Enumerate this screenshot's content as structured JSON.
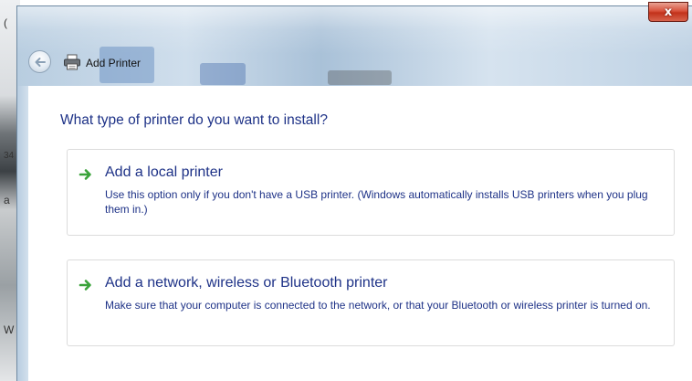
{
  "left_strip": {
    "glyphs": [
      "(",
      "34",
      "a",
      "W"
    ]
  },
  "window": {
    "title": "Add Printer",
    "close_label": "x",
    "icons": {
      "back": "back-arrow-icon",
      "title": "printer-icon",
      "option": "green-arrow-icon"
    },
    "colors": {
      "heading": "#1e3287",
      "close": "#c2321b",
      "option_arrow": "#3aa33a"
    }
  },
  "content": {
    "heading": "What type of printer do you want to install?",
    "options": [
      {
        "title": "Add a local printer",
        "description": "Use this option only if you don't have a USB printer. (Windows automatically installs USB printers when you plug them in.)"
      },
      {
        "title": "Add a network, wireless or Bluetooth printer",
        "description": "Make sure that your computer is connected to the network, or that your Bluetooth or wireless printer is turned on."
      }
    ]
  }
}
